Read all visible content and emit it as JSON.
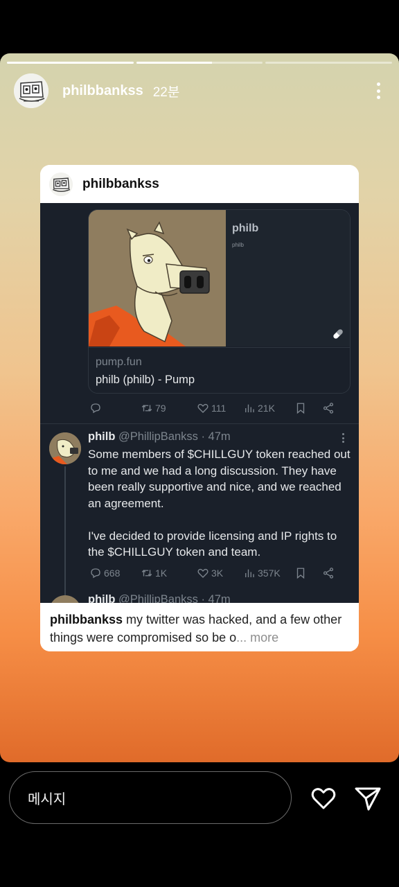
{
  "story": {
    "progress": [
      1.0,
      0.6,
      0.0
    ],
    "username": "philbbankss",
    "time_ago": "22분"
  },
  "card": {
    "username": "philbbankss",
    "link": {
      "title": "philb",
      "subtitle": "philb",
      "domain": "pump.fun",
      "page_title": "philb (philb) - Pump"
    },
    "first_actions": {
      "replies": "",
      "retweets": "79",
      "likes": "111",
      "views": "21K"
    },
    "tweet": {
      "name": "philb",
      "handle_time": "@PhillipBankss · 47m",
      "paragraph1": "Some members of $CHILLGUY token reached out to me and we had a long discussion. They have been really supportive and nice, and we reached an agreement.",
      "paragraph2": "I've decided to provide licensing and IP rights to the $CHILLGUY token and team.",
      "replies": "668",
      "retweets": "1K",
      "likes": "3K",
      "views": "357K"
    },
    "next_tweet": {
      "name": "philb",
      "handle_time": "@PhillipBankss · 47m"
    },
    "caption": {
      "user": "philbbankss",
      "text": "my twitter was hacked, and a few other things were compromised so be o",
      "ellipsis": "... ",
      "more": "more"
    }
  },
  "footer": {
    "message_placeholder": "메시지"
  },
  "colors": {
    "tweet_bg": "#1a202a",
    "muted": "#7d858e",
    "gradient_top": "#d4d3ae",
    "gradient_bottom": "#e06b2a"
  },
  "icons": [
    "more-vertical-icon",
    "pill-icon",
    "reply-icon",
    "retweet-icon",
    "like-icon",
    "views-icon",
    "bookmark-icon",
    "share-icon",
    "heart-icon",
    "send-icon"
  ]
}
